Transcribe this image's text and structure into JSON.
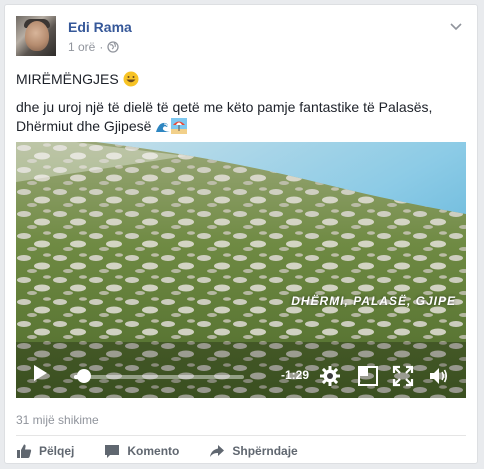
{
  "post": {
    "author": "Edi Rama",
    "time": "1 orë",
    "greeting": "MIRËMËNGJES",
    "body": "dhe ju uroj një të dielë të qetë me këto pamje fantastike të Palasës, Dhërmiut dhe Gjipesë"
  },
  "video": {
    "overlay_text": "DHËRMI, PALASË, GJIPE",
    "remaining": "-1:29",
    "progress": 0.06
  },
  "stats": {
    "views": "31 mijë shikime"
  },
  "actions": {
    "like": "Pëlqej",
    "comment": "Komento",
    "share": "Shpërndaje"
  },
  "icons": [
    "globe-icon",
    "chevron-down-icon",
    "grinning-emoji",
    "wave-emoji",
    "beach-emoji",
    "play-icon",
    "settings-icon",
    "exit-fullscreen-icon",
    "fullscreen-icon",
    "volume-icon",
    "like-icon",
    "comment-icon",
    "share-icon"
  ],
  "colors": {
    "link": "#365899",
    "muted": "#90949c"
  }
}
